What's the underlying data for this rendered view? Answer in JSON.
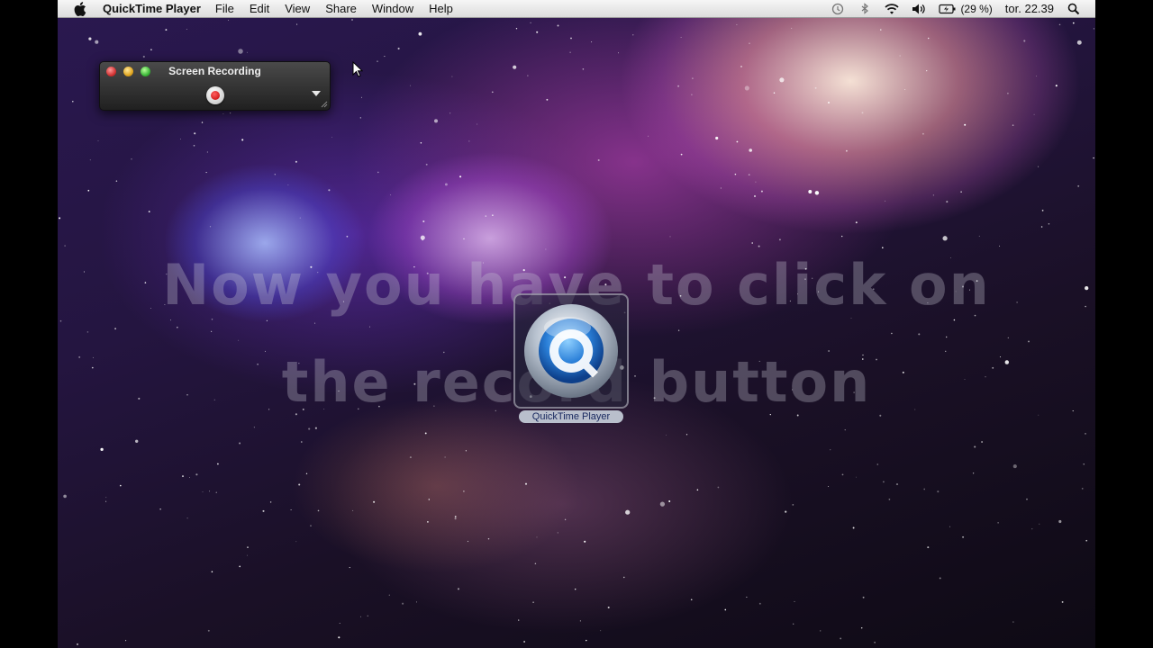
{
  "menubar": {
    "app_name": "QuickTime Player",
    "items": [
      "File",
      "Edit",
      "View",
      "Share",
      "Window",
      "Help"
    ],
    "battery_text": "(29 %)",
    "clock": "tor. 22.39"
  },
  "recording_window": {
    "title": "Screen Recording"
  },
  "desktop_icon": {
    "label": "QuickTime Player"
  },
  "overlay": {
    "line1": "Now you have to click on",
    "line2": "the record button"
  },
  "colors": {
    "record_red": "#c00000",
    "icon_blue": "#2a7fd8"
  }
}
